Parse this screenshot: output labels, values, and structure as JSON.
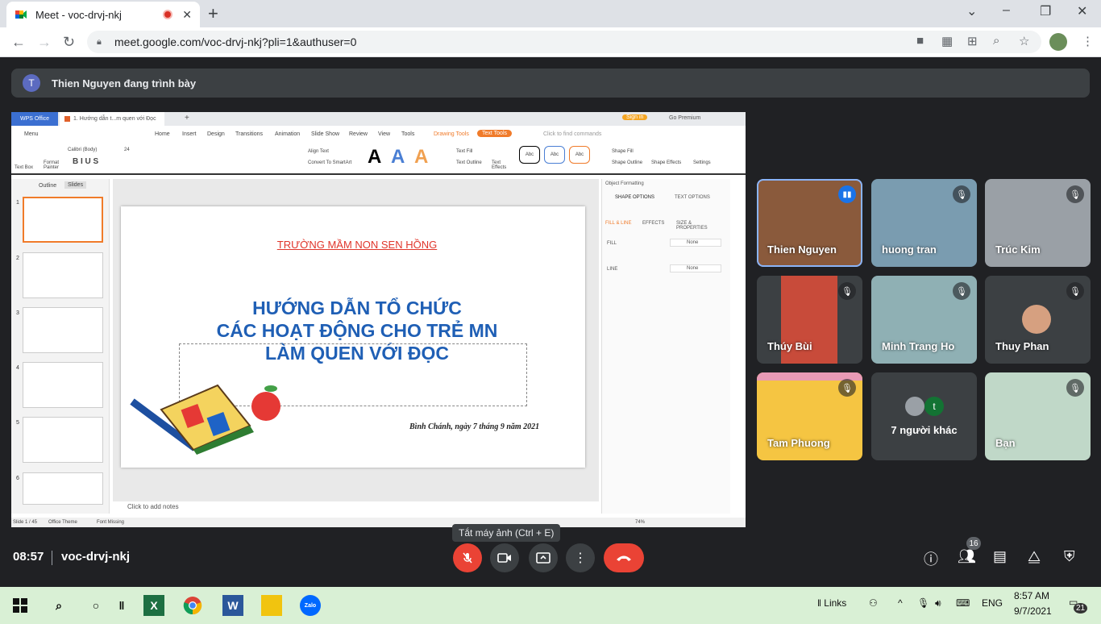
{
  "browser": {
    "tab_title": "Meet - voc-drvj-nkj",
    "url": "meet.google.com/voc-drvj-nkj?pli=1&authuser=0"
  },
  "meet": {
    "presenter_initial": "T",
    "presenter_text": "Thien Nguyen đang trình bày",
    "time": "08:57",
    "meeting_code": "voc-drvj-nkj",
    "tooltip": "Tắt máy ảnh (Ctrl + E)",
    "participant_count": "16",
    "participants": [
      {
        "name": "Thien Nguyen",
        "color": "#8a5a3c"
      },
      {
        "name": "huong tran",
        "color": "#7a9cb0"
      },
      {
        "name": "Trúc Kim",
        "color": "#9aa0a6"
      },
      {
        "name": "Thúy Bùi",
        "color": "#c84b3a"
      },
      {
        "name": "Minh Trang Ho",
        "color": "#8fb0b4"
      },
      {
        "name": "Thuy Phan",
        "color": "#3c4043"
      },
      {
        "name": "Tam Phuong",
        "color": "#f5c542"
      },
      {
        "name": "7 người khác",
        "color": "#3c4043"
      },
      {
        "name": "Bạn",
        "color": "#c0d8c8"
      }
    ],
    "others_initial": "t"
  },
  "wps": {
    "app_tab": "WPS Office",
    "doc_tab": "1. Hướng dẫn t...m quen với Đọc",
    "sign_in": "Sign in",
    "go_premium": "Go Premium",
    "menu": "Menu",
    "ribbon_tabs": [
      "Home",
      "Insert",
      "Design",
      "Transitions",
      "Animation",
      "Slide Show",
      "Review",
      "View",
      "Tools"
    ],
    "drawing_tools": "Drawing Tools",
    "text_tools": "Text Tools",
    "find": "Click to find commands",
    "font": "Calibri (Body)",
    "font_size": "24",
    "ribbon_labels": {
      "text_box": "Text Box",
      "format_painter": "Format Painter",
      "align_text": "Align Text",
      "convert": "Convert To SmartArt",
      "text_fill": "Text Fill",
      "text_outline": "Text Outline",
      "text_effects": "Text Effects",
      "shape_fill": "Shape Fill",
      "shape_outline": "Shape Outline",
      "shape_effects": "Shape Effects",
      "settings": "Settings",
      "abc": "Abc"
    },
    "panel_tabs": [
      "Outline",
      "Slides"
    ],
    "slide_numbers": [
      "1",
      "2",
      "3",
      "4",
      "5",
      "6"
    ],
    "slide": {
      "school": "TRƯỜNG MẦM NON SEN HỒNG",
      "title_lines": [
        "HƯỚNG DẪN TỔ CHỨC",
        "CÁC HOẠT ĐỘNG CHO TRẺ MN",
        "LÀM QUEN VỚI ĐỌC"
      ],
      "date": "Bình Chánh, ngày 7 tháng 9 năm 2021"
    },
    "notes": "Click to add notes",
    "object_formatting": "Object Formatting",
    "shape_options": "SHAPE OPTIONS",
    "text_options": "TEXT OPTIONS",
    "fill_line": "FILL & LINE",
    "effects": "EFFECTS",
    "size": "SIZE & PROPERTIES",
    "fill": "FILL",
    "line": "LINE",
    "none": "None",
    "status_slide": "Slide 1 / 45",
    "status_theme": "Office Theme",
    "status_font": "Font Missing",
    "zoom": "74%"
  },
  "taskbar": {
    "links": "Links",
    "lang": "ENG",
    "clock_time": "8:57 AM",
    "clock_date": "9/7/2021",
    "notif": "21",
    "zalo": "Zalo"
  }
}
